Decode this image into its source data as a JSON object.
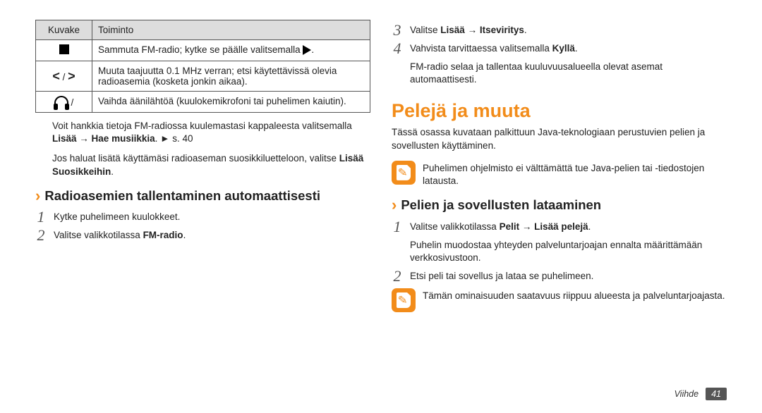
{
  "table": {
    "head_icon": "Kuvake",
    "head_func": "Toiminto",
    "row1": "Sammuta FM-radio; kytke se päälle valitsemalla ",
    "row1_end": ".",
    "row2": "Muuta taajuutta 0.1 MHz verran; etsi käytettävissä olevia radioasemia (kosketa jonkin aikaa).",
    "row3": "Vaihda äänilähtöä (kuulokemikrofoni tai puhelimen kaiutin)."
  },
  "left": {
    "p1_a": "Voit hankkia tietoja FM-radiossa kuulemastasi kappaleesta valitsemalla ",
    "p1_b": "Lisää",
    "p1_c": " → ",
    "p1_d": "Hae musiikkia",
    "p1_e": ". ► s. 40",
    "p2_a": "Jos haluat lisätä käyttämäsi radioaseman suosikkiluetteloon, valitse ",
    "p2_b": "Lisää Suosikkeihin",
    "p2_c": ".",
    "h1": "Radioasemien tallentaminen automaattisesti",
    "s1": "Kytke puhelimeen kuulokkeet.",
    "s2_a": "Valitse valikkotilassa ",
    "s2_b": "FM-radio",
    "s2_c": "."
  },
  "right": {
    "s3_a": "Valitse ",
    "s3_b": "Lisää",
    "s3_c": " → ",
    "s3_d": "Itseviritys",
    "s3_e": ".",
    "s4_a": "Vahvista tarvittaessa valitsemalla ",
    "s4_b": "Kyllä",
    "s4_c": ".",
    "s4_after": "FM-radio selaa ja tallentaa kuuluvuusalueella olevat asemat automaattisesti.",
    "title": "Pelejä ja muuta",
    "desc": "Tässä osassa kuvataan palkittuun Java-teknologiaan perustuvien pelien ja sovellusten käyttäminen.",
    "note1": "Puhelimen ohjelmisto ei välttämättä tue Java-pelien tai -tiedostojen latausta.",
    "h2": "Pelien ja sovellusten lataaminen",
    "d1_a": "Valitse valikkotilassa ",
    "d1_b": "Pelit",
    "d1_c": " → ",
    "d1_d": "Lisää pelejä",
    "d1_e": ".",
    "d1_after": "Puhelin muodostaa yhteyden palveluntarjoajan ennalta määrittämään verkkosivustoon.",
    "d2": "Etsi peli tai sovellus ja lataa se puhelimeen.",
    "note2": "Tämän ominaisuuden saatavuus riippuu alueesta ja palveluntarjoajasta."
  },
  "footer": {
    "section": "Viihde",
    "page": "41"
  }
}
